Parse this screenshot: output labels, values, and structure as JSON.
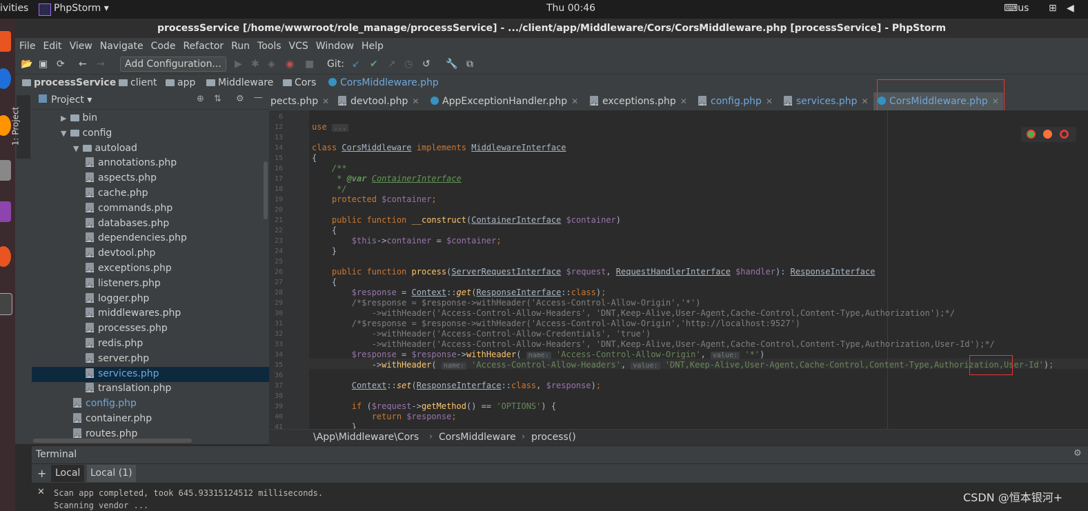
{
  "topbar": {
    "activities": "ivities",
    "app_menu": "PhpStorm",
    "clock": "Thu 00:46",
    "keyboard": "us"
  },
  "window": {
    "title": "processService [/home/wwwroot/role_manage/processService] - .../client/app/Middleware/Cors/CorsMiddleware.php [processService] - PhpStorm"
  },
  "menu": [
    "File",
    "Edit",
    "View",
    "Navigate",
    "Code",
    "Refactor",
    "Run",
    "Tools",
    "VCS",
    "Window",
    "Help"
  ],
  "toolbar": {
    "add_configuration": "Add Configuration...",
    "git_label": "Git:"
  },
  "navbar": [
    "processService",
    "client",
    "app",
    "Middleware",
    "Cors",
    "CorsMiddleware.php"
  ],
  "sidestrip": {
    "project_tab": "1: Project"
  },
  "project_panel": {
    "title": "Project",
    "items": [
      {
        "label": "bin",
        "type": "folder",
        "level": 2
      },
      {
        "label": "config",
        "type": "folder",
        "level": 2
      },
      {
        "label": "autoload",
        "type": "folder",
        "level": 3
      },
      {
        "label": "annotations.php",
        "type": "file",
        "level": 4
      },
      {
        "label": "aspects.php",
        "type": "file",
        "level": 4
      },
      {
        "label": "cache.php",
        "type": "file",
        "level": 4
      },
      {
        "label": "commands.php",
        "type": "file",
        "level": 4
      },
      {
        "label": "databases.php",
        "type": "file",
        "level": 4
      },
      {
        "label": "dependencies.php",
        "type": "file",
        "level": 4
      },
      {
        "label": "devtool.php",
        "type": "file",
        "level": 4
      },
      {
        "label": "exceptions.php",
        "type": "file",
        "level": 4
      },
      {
        "label": "listeners.php",
        "type": "file",
        "level": 4
      },
      {
        "label": "logger.php",
        "type": "file",
        "level": 4
      },
      {
        "label": "middlewares.php",
        "type": "file",
        "level": 4
      },
      {
        "label": "processes.php",
        "type": "file",
        "level": 4
      },
      {
        "label": "redis.php",
        "type": "file",
        "level": 4
      },
      {
        "label": "server.php",
        "type": "file",
        "level": 4
      },
      {
        "label": "services.php",
        "type": "file",
        "level": 4
      },
      {
        "label": "translation.php",
        "type": "file",
        "level": 4
      },
      {
        "label": "config.php",
        "type": "file",
        "level": 3
      },
      {
        "label": "container.php",
        "type": "file",
        "level": 3
      },
      {
        "label": "routes.php",
        "type": "file",
        "level": 3
      }
    ]
  },
  "tabs": [
    "pects.php",
    "devtool.php",
    "AppExceptionHandler.php",
    "exceptions.php",
    "config.php",
    "services.php",
    "CorsMiddleware.php"
  ],
  "editor": {
    "line_numbers": [
      "6",
      "12",
      "13",
      "14",
      "15",
      "16",
      "17",
      "18",
      "19",
      "20",
      "21",
      "22",
      "23",
      "24",
      "25",
      "26",
      "27",
      "28",
      "29",
      "30",
      "31",
      "32",
      "33",
      "34",
      "35",
      "36",
      "37",
      "38",
      "39",
      "40",
      "41"
    ],
    "use_folded": "...",
    "hint_name": "name:",
    "hint_value": "value:"
  },
  "code_breadcrumb": [
    "\\App\\Middleware\\Cors",
    "CorsMiddleware",
    "process()"
  ],
  "terminal": {
    "title": "Terminal",
    "tabs": [
      "Local",
      "Local (1)"
    ],
    "lines": [
      "Scan app completed, took 645.93315124512 milliseconds.",
      "Scanning vendor ..."
    ]
  },
  "watermark": "CSDN @恒本银河+",
  "colors": {
    "keyword": "#cc7832",
    "string": "#6a8759",
    "variable": "#9876aa",
    "comment": "#808080",
    "highlight_box": "#e53935"
  }
}
